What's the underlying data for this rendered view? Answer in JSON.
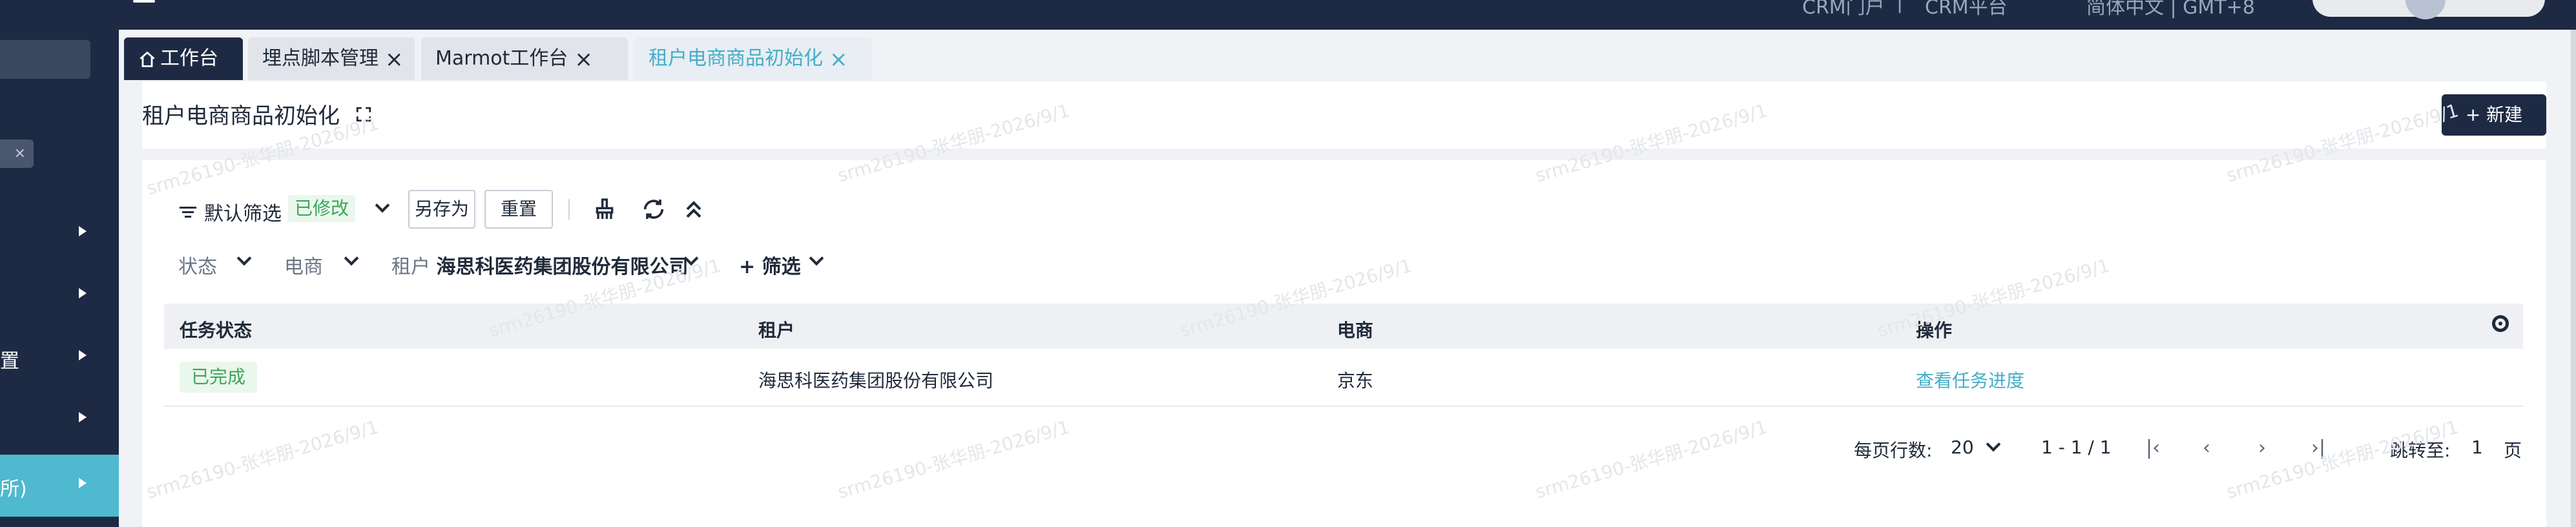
{
  "topbar": {
    "right_items": [
      "CRM门户",
      "|",
      "CRM平台",
      "简体中文 | GMT+8"
    ]
  },
  "sidebar": {
    "tag": "×",
    "items": [
      {
        "label": "",
        "active": false
      },
      {
        "label": "",
        "active": false
      },
      {
        "label": "置",
        "active": false
      },
      {
        "label": "",
        "active": false
      },
      {
        "label": "所)",
        "active": true
      }
    ]
  },
  "tabs": [
    {
      "label": "工作台",
      "icon": "home-icon",
      "active": true
    },
    {
      "label": "埋点脚本管理",
      "closable": true
    },
    {
      "label": "Marmot工作台",
      "closable": true
    },
    {
      "label": "租户电商商品初始化",
      "closable": true,
      "current": true
    }
  ],
  "header": {
    "title": "租户电商商品初始化",
    "new_button": "+ 新建"
  },
  "filters": {
    "title": "默认筛选",
    "modified_badge": "已修改",
    "save_as": "另存为",
    "reset": "重置",
    "conditions": [
      {
        "label": "状态",
        "value": ""
      },
      {
        "label": "电商",
        "value": ""
      },
      {
        "label": "租户",
        "value": "海思科医药集团股份有限公司"
      }
    ],
    "add_filter": "+ 筛选"
  },
  "table": {
    "columns": [
      "任务状态",
      "租户",
      "电商",
      "操作"
    ],
    "rows": [
      {
        "status": "已完成",
        "tenant": "海思科医药集团股份有限公司",
        "platform": "京东",
        "action": "查看任务进度"
      }
    ]
  },
  "pagination": {
    "rows_per_page_label": "每页行数:",
    "rows_per_page": "20",
    "range": "1 - 1 / 1",
    "jump_label": "跳转至:",
    "page": "1",
    "page_unit": "页"
  },
  "watermark": "srm26190-张华朋-2026/9/1",
  "colors": {
    "nav_bg": "#1e2a44",
    "accent": "#4fb9cf",
    "success": "#3da65a",
    "link": "#45aec7"
  }
}
